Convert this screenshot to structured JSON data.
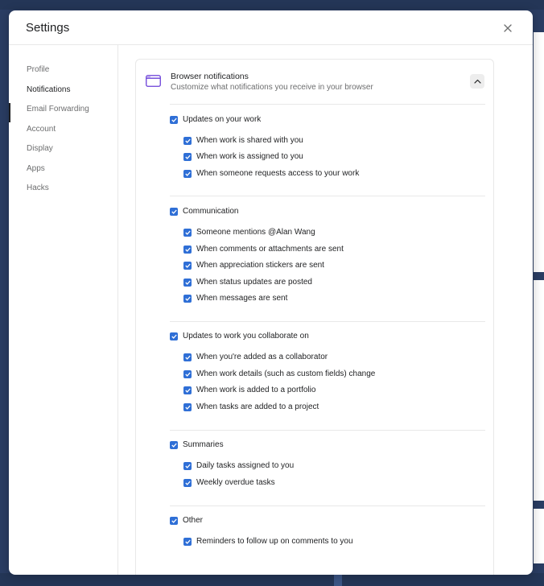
{
  "modal": {
    "title": "Settings"
  },
  "sidebar": {
    "items": [
      {
        "label": "Profile"
      },
      {
        "label": "Notifications"
      },
      {
        "label": "Email Forwarding"
      },
      {
        "label": "Account"
      },
      {
        "label": "Display"
      },
      {
        "label": "Apps"
      },
      {
        "label": "Hacks"
      }
    ],
    "active": "Notifications"
  },
  "section": {
    "title": "Browser notifications",
    "subtitle": "Customize what notifications you receive in your browser",
    "icon": "browser-window-icon"
  },
  "groups": [
    {
      "label": "Updates on your work",
      "checked": true,
      "items": [
        {
          "label": "When work is shared with you",
          "checked": true
        },
        {
          "label": "When work is assigned to you",
          "checked": true
        },
        {
          "label": "When someone requests access to your work",
          "checked": true
        }
      ]
    },
    {
      "label": "Communication",
      "checked": true,
      "items": [
        {
          "label": "Someone mentions @Alan Wang",
          "checked": true
        },
        {
          "label": "When comments or attachments are sent",
          "checked": true
        },
        {
          "label": "When appreciation stickers are sent",
          "checked": true
        },
        {
          "label": "When status updates are posted",
          "checked": true
        },
        {
          "label": "When messages are sent",
          "checked": true
        }
      ]
    },
    {
      "label": "Updates to work you collaborate on",
      "checked": true,
      "items": [
        {
          "label": "When you're added as a collaborator",
          "checked": true
        },
        {
          "label": "When work details (such as custom fields) change",
          "checked": true
        },
        {
          "label": "When work is added to a portfolio",
          "checked": true
        },
        {
          "label": "When tasks are added to a project",
          "checked": true
        }
      ]
    },
    {
      "label": "Summaries",
      "checked": true,
      "items": [
        {
          "label": "Daily tasks assigned to you",
          "checked": true
        },
        {
          "label": "Weekly overdue tasks",
          "checked": true
        }
      ]
    },
    {
      "label": "Other",
      "checked": true,
      "items": [
        {
          "label": "Reminders to follow up on comments to you",
          "checked": true
        }
      ]
    }
  ],
  "colors": {
    "checkbox": "#2f6fd6",
    "icon_accent": "#6a3fd8"
  }
}
